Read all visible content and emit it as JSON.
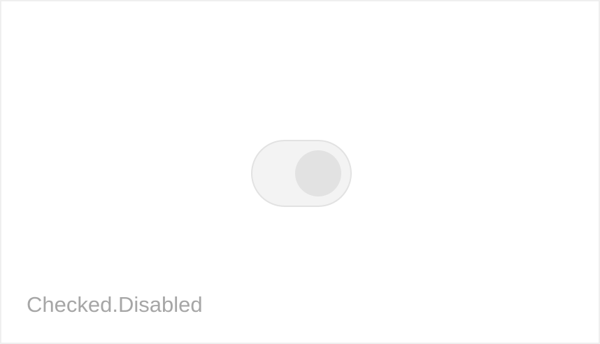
{
  "toggle": {
    "checked": true,
    "disabled": true,
    "colors": {
      "track": "#f3f3f3",
      "track_border": "#e2e2e2",
      "knob": "#e2e2e2"
    }
  },
  "caption": {
    "label": "Checked.Disabled",
    "color": "#a6a6a6"
  }
}
